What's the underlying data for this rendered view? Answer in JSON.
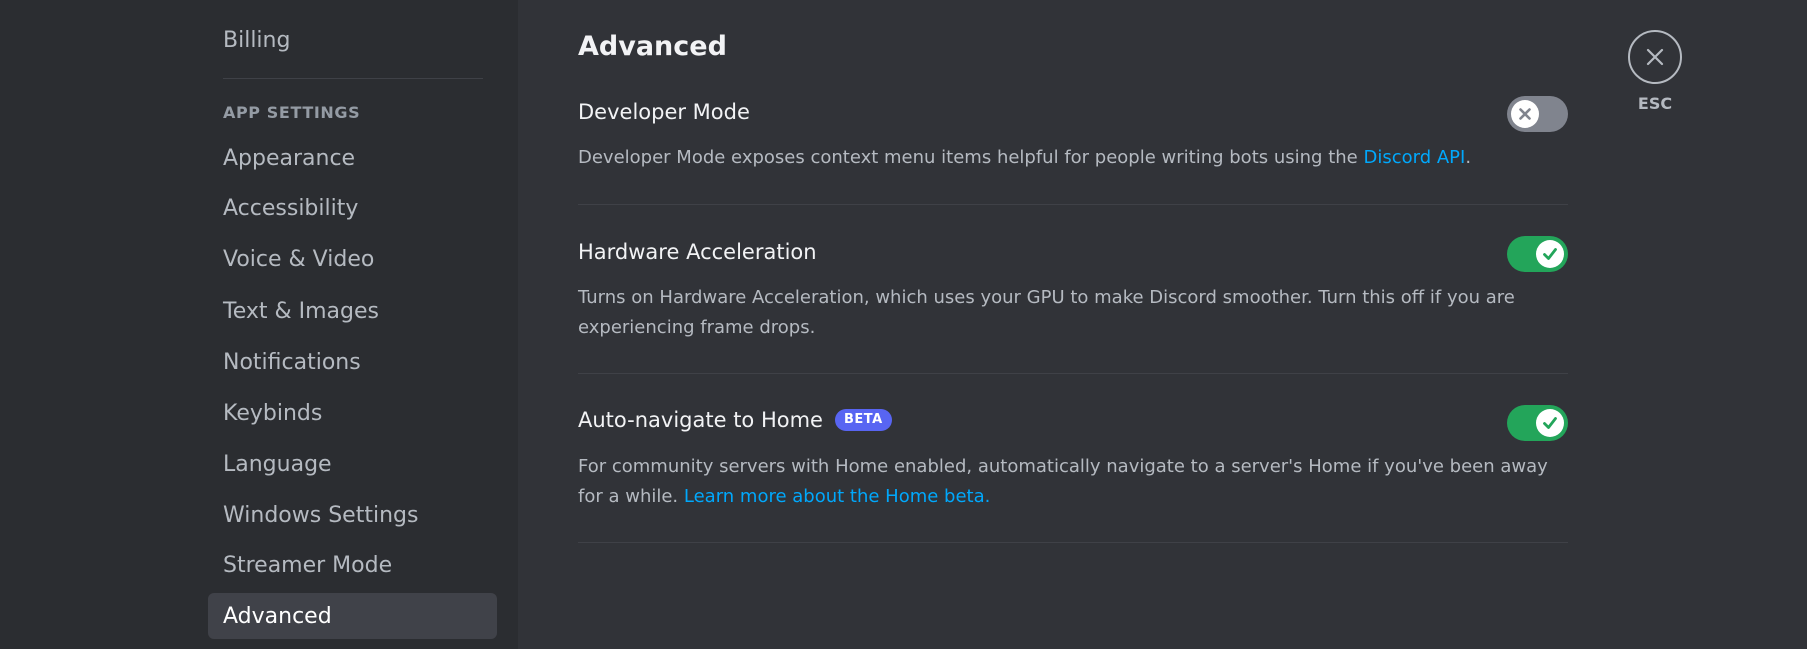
{
  "sidebar": {
    "billing_label": "Billing",
    "section_header": "APP SETTINGS",
    "items": [
      {
        "label": "Appearance"
      },
      {
        "label": "Accessibility"
      },
      {
        "label": "Voice & Video"
      },
      {
        "label": "Text & Images"
      },
      {
        "label": "Notifications"
      },
      {
        "label": "Keybinds"
      },
      {
        "label": "Language"
      },
      {
        "label": "Windows Settings"
      },
      {
        "label": "Streamer Mode"
      },
      {
        "label": "Advanced",
        "selected": true
      }
    ]
  },
  "main": {
    "title": "Advanced",
    "settings": [
      {
        "title": "Developer Mode",
        "description": "Developer Mode exposes context menu items helpful for people writing bots using the ",
        "link": "Discord API",
        "description_suffix": ".",
        "enabled": false
      },
      {
        "title": "Hardware Acceleration",
        "description": "Turns on Hardware Acceleration, which uses your GPU to make Discord smoother. Turn this off if you are experiencing frame drops.",
        "enabled": true
      },
      {
        "title": "Auto-navigate to Home",
        "badge": "BETA",
        "description": "For community servers with Home enabled, automatically navigate to a server's Home if you've been away for a while. ",
        "link": "Learn more about the Home beta.",
        "enabled": true
      }
    ]
  },
  "close": {
    "icon": "close-icon",
    "label": "ESC"
  },
  "colors": {
    "accent": "#5865f2",
    "toggle_on": "#23a55a",
    "toggle_off": "#80848e",
    "link": "#00a8fc"
  }
}
